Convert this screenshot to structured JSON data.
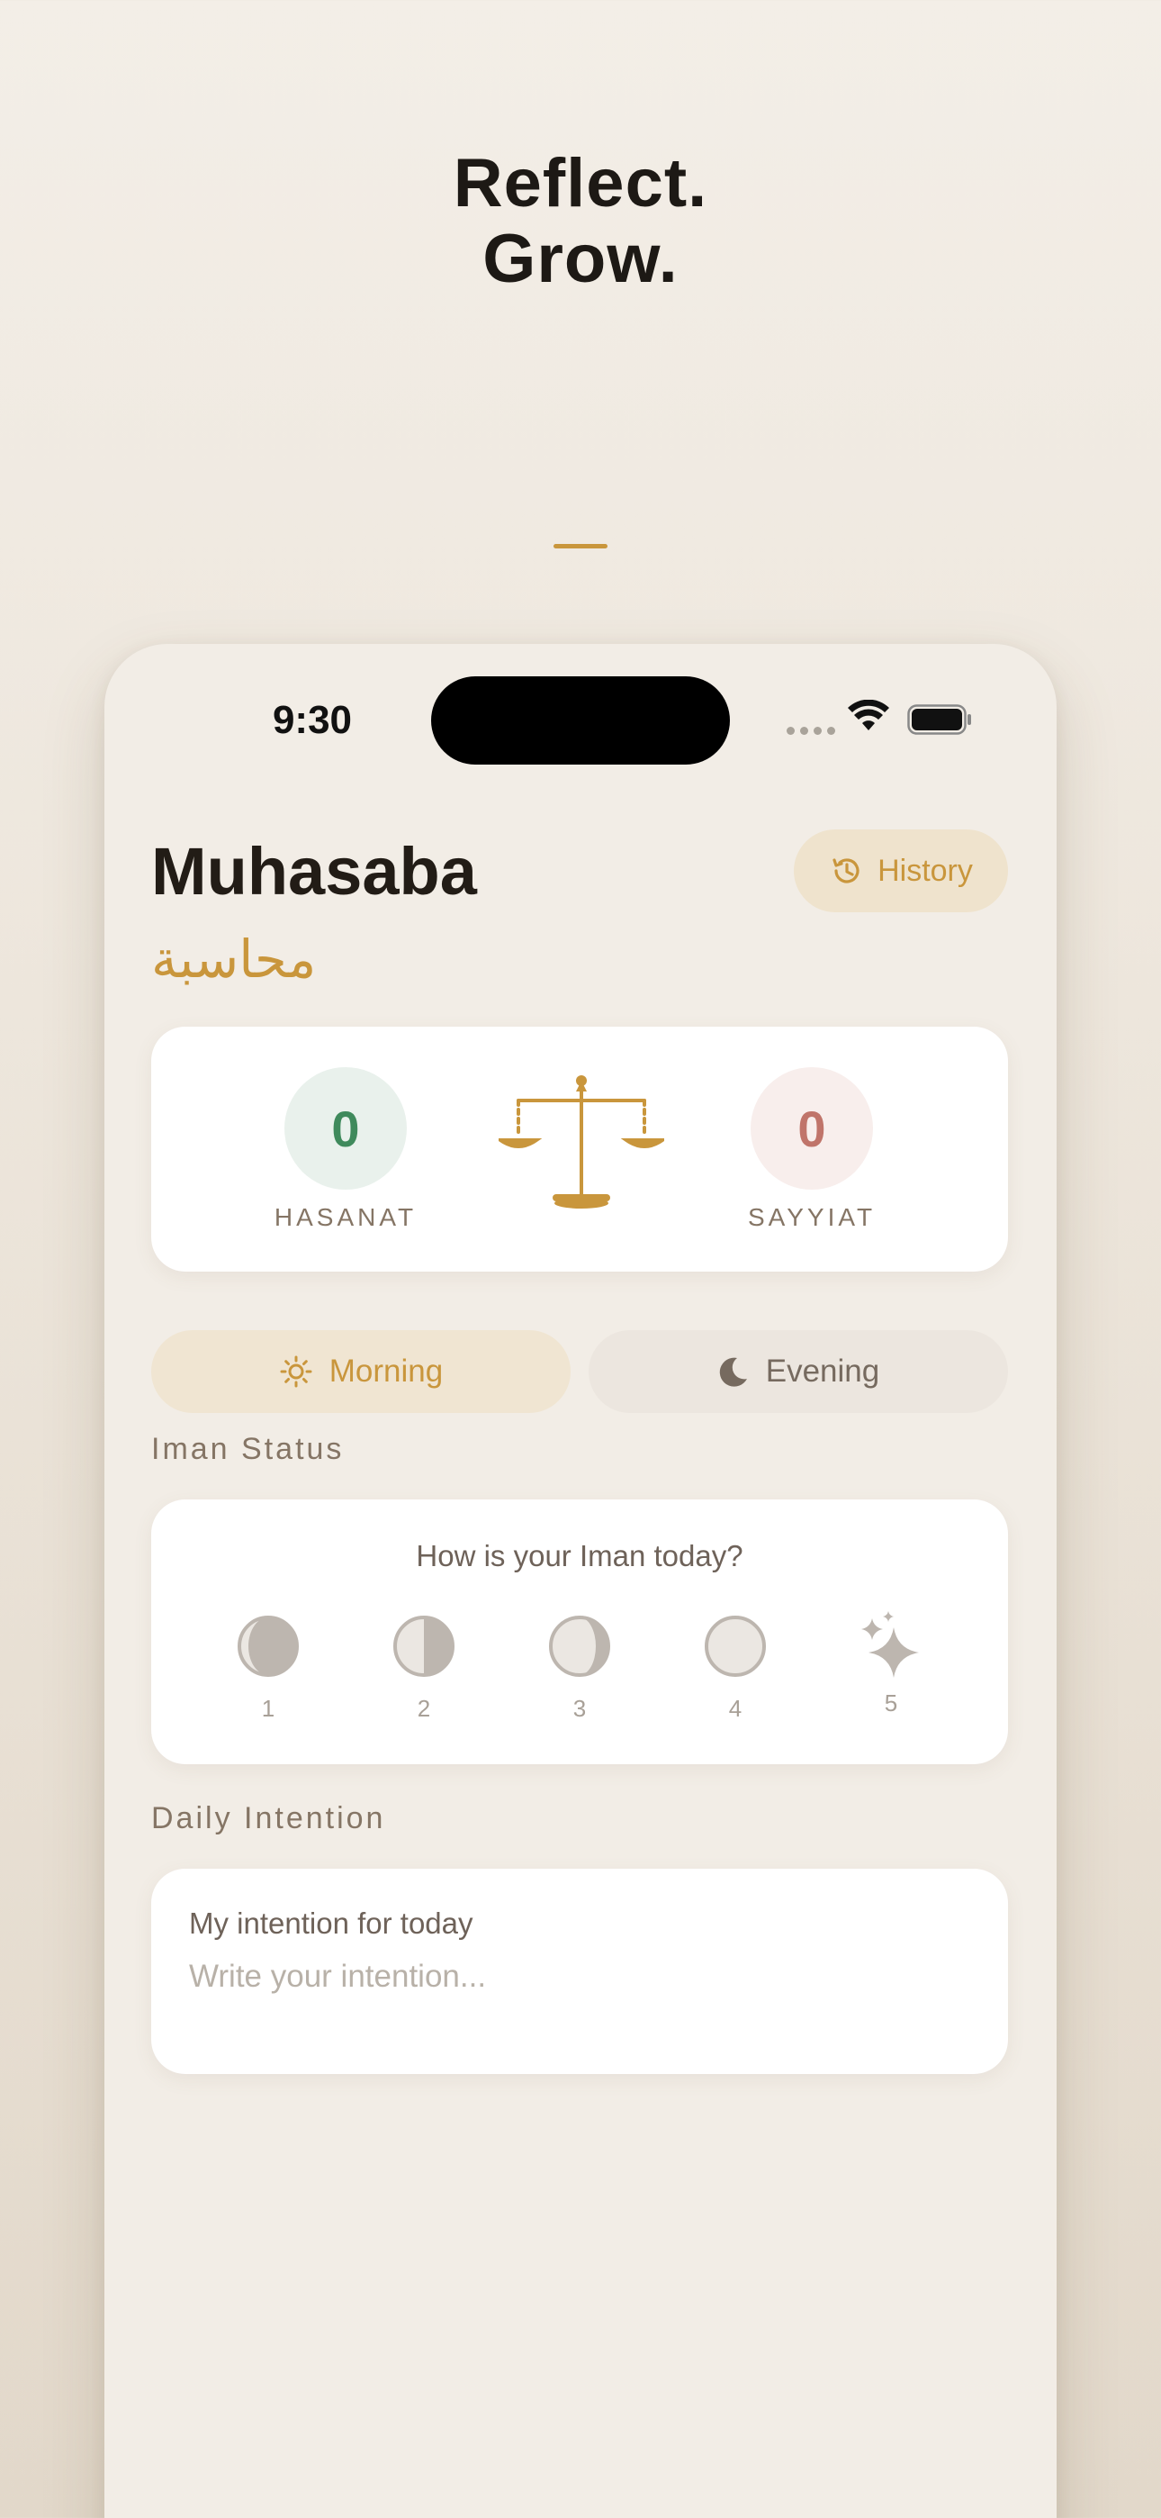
{
  "promo": {
    "line1": "Reflect.",
    "line2": "Grow."
  },
  "status_bar": {
    "time": "9:30"
  },
  "header": {
    "title": "Muhasaba",
    "subtitle_arabic": "محاسبة",
    "history_label": "History"
  },
  "scale": {
    "hasanat_count": "0",
    "hasanat_label": "HASANAT",
    "sayyiat_count": "0",
    "sayyiat_label": "SAYYIAT"
  },
  "segments": {
    "morning_label": "Morning",
    "evening_label": "Evening",
    "selected": "Morning"
  },
  "iman": {
    "section_label": "Iman Status",
    "question": "How is your Iman today?",
    "options": [
      {
        "num": "1",
        "icon": "moon-phase-1-icon"
      },
      {
        "num": "2",
        "icon": "moon-phase-2-icon"
      },
      {
        "num": "3",
        "icon": "moon-phase-3-icon"
      },
      {
        "num": "4",
        "icon": "moon-phase-4-icon"
      },
      {
        "num": "5",
        "icon": "sparkles-icon"
      }
    ]
  },
  "intention": {
    "section_label": "Daily Intention",
    "label": "My intention for today",
    "placeholder": "Write your intention..."
  },
  "colors": {
    "accent": "#c9963c",
    "hasanat": "#3f8a5c",
    "sayyiat": "#c0746a",
    "background": "#f2ede6"
  }
}
